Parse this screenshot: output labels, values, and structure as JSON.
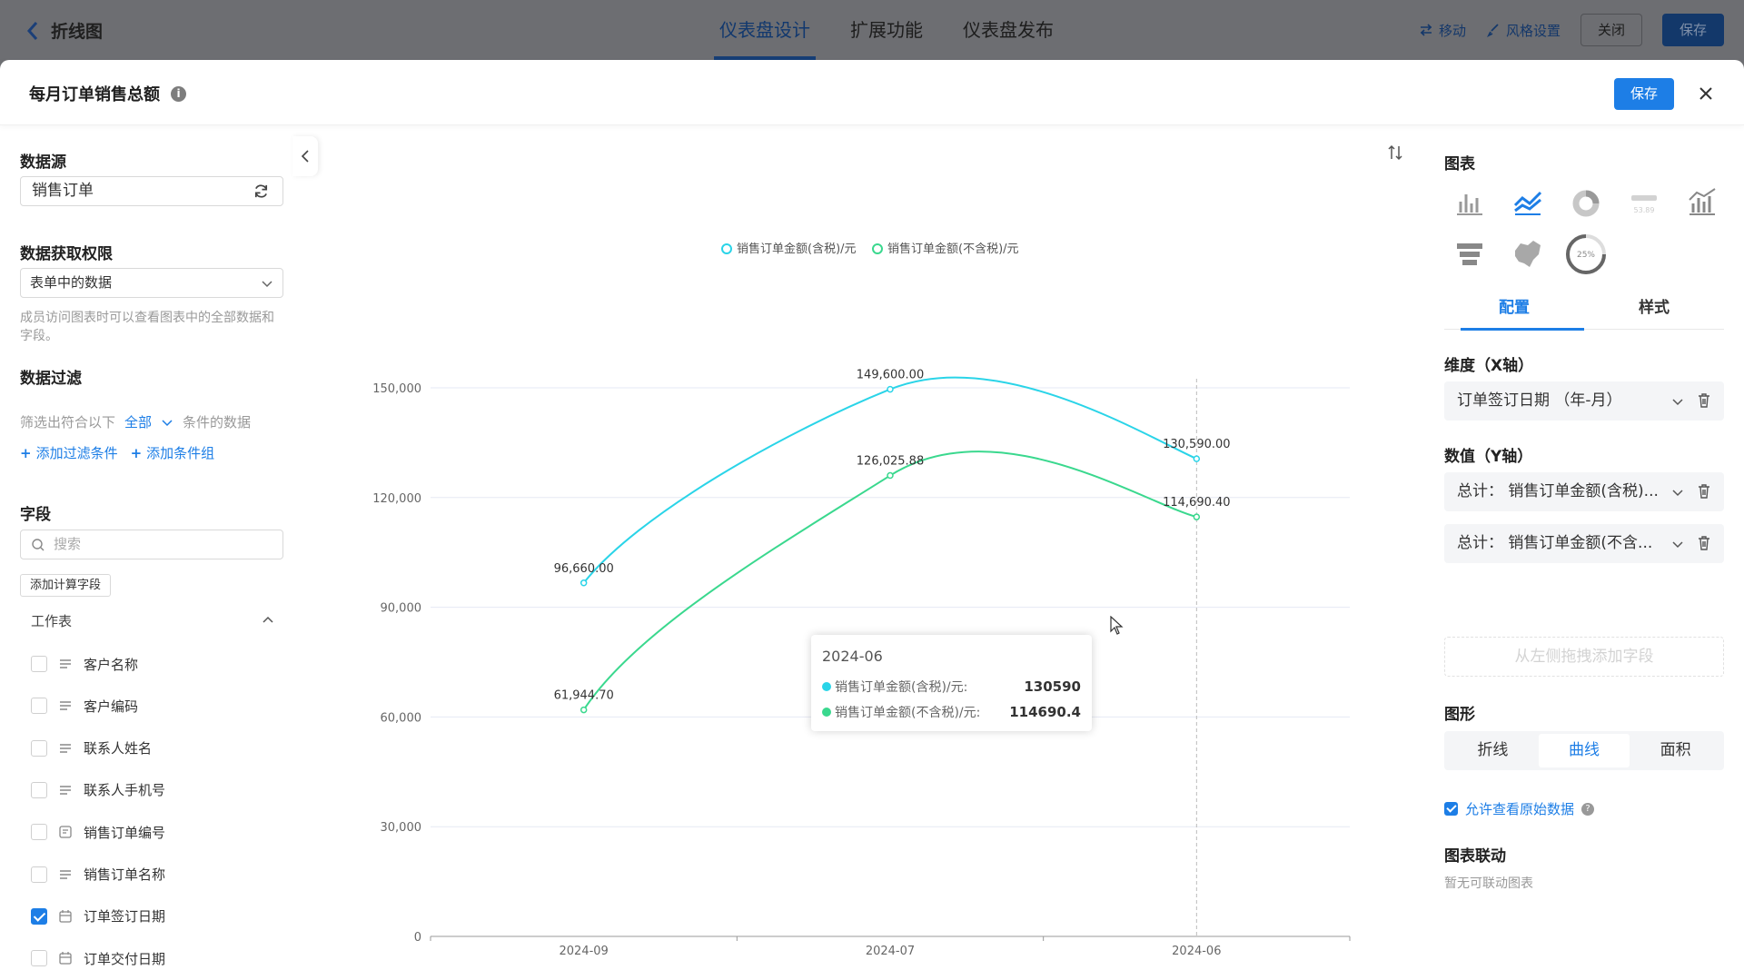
{
  "topbar": {
    "back_label": "折线图",
    "tabs": [
      "仪表盘设计",
      "扩展功能",
      "仪表盘发布"
    ],
    "move_label": "移动",
    "style_label": "风格设置",
    "close_label": "关闭",
    "save_label": "保存"
  },
  "dialog": {
    "title": "每月订单销售总额",
    "save_label": "保存"
  },
  "left": {
    "datasource_title": "数据源",
    "datasource_value": "销售订单",
    "permission_title": "数据获取权限",
    "permission_value": "表单中的数据",
    "permission_help": "成员访问图表时可以查看图表中的全部数据和字段。",
    "filter_title": "数据过滤",
    "filter_prefix": "筛选出符合以下",
    "filter_all": "全部",
    "filter_suffix": "条件的数据",
    "add_filter": "添加过滤条件",
    "add_group": "添加条件组",
    "fields_title": "字段",
    "search_placeholder": "搜索",
    "calc_field_button": "添加计算字段",
    "worksheet_label": "工作表",
    "fields": [
      {
        "label": "客户名称",
        "checked": false,
        "icon": "text-lines-icon"
      },
      {
        "label": "客户编码",
        "checked": false,
        "icon": "text-lines-icon"
      },
      {
        "label": "联系人姓名",
        "checked": false,
        "icon": "text-lines-icon"
      },
      {
        "label": "联系人手机号",
        "checked": false,
        "icon": "text-lines-icon"
      },
      {
        "label": "销售订单编号",
        "checked": false,
        "icon": "serial-number-icon"
      },
      {
        "label": "销售订单名称",
        "checked": false,
        "icon": "text-lines-icon"
      },
      {
        "label": "订单签订日期",
        "checked": true,
        "icon": "calendar-icon"
      },
      {
        "label": "订单交付日期",
        "checked": false,
        "icon": "calendar-icon"
      }
    ]
  },
  "chart_data": {
    "type": "line",
    "curve": "smooth",
    "categories": [
      "2024-09",
      "2024-07",
      "2024-06"
    ],
    "series": [
      {
        "name": "销售订单金额(含税)/元",
        "color": "#2ad4e8",
        "values": [
          96660.0,
          149600.0,
          130590.0
        ],
        "labels": [
          "96,660.00",
          "149,600.00",
          "130,590.00"
        ]
      },
      {
        "name": "销售订单金额(不含税)/元",
        "color": "#3ad88e",
        "values": [
          61944.7,
          126025.88,
          114690.4
        ],
        "labels": [
          "61,944.70",
          "126,025.88",
          "114,690.40"
        ]
      }
    ],
    "ylim": [
      0,
      150000
    ],
    "yticks": [
      0,
      30000,
      60000,
      90000,
      120000,
      150000
    ],
    "ytick_labels": [
      "0",
      "30,000",
      "60,000",
      "90,000",
      "120,000",
      "150,000"
    ],
    "legend_position": "top-center",
    "grid": true
  },
  "tooltip": {
    "title": "2024-06",
    "rows": [
      {
        "name": "销售订单金额(含税)/元:",
        "value": "130590",
        "color": "#2ad4e8"
      },
      {
        "name": "销售订单金额(不含税)/元:",
        "value": "114690.4",
        "color": "#3ad88e"
      }
    ]
  },
  "right": {
    "chart_title": "图表",
    "chart_types": [
      "bar-chart-icon",
      "line-chart-icon",
      "donut-chart-icon",
      "number-card-icon",
      "combo-chart-icon",
      "funnel-chart-icon",
      "map-chart-icon",
      "gauge-chart-icon"
    ],
    "gauge_text": "25%",
    "number_card_text": "53.89",
    "tabs": [
      "配置",
      "样式"
    ],
    "dimension_title": "维度（X轴）",
    "dimension_value": "订单签订日期 （年-月）",
    "value_title": "数值（Y轴）",
    "value_items": [
      "总计：  销售订单金额(含税)...",
      "总计：  销售订单金额(不含..."
    ],
    "drop_hint": "从左侧拖拽添加字段",
    "shape_title": "图形",
    "shape_options": [
      "折线",
      "曲线",
      "面积"
    ],
    "shape_selected": 1,
    "allow_raw_label": "允许查看原始数据",
    "linkage_title": "图表联动",
    "linkage_empty": "暂无可联动图表"
  },
  "colors": {
    "accent": "#1d7ee6",
    "series1": "#2ad4e8",
    "series2": "#3ad88e"
  }
}
